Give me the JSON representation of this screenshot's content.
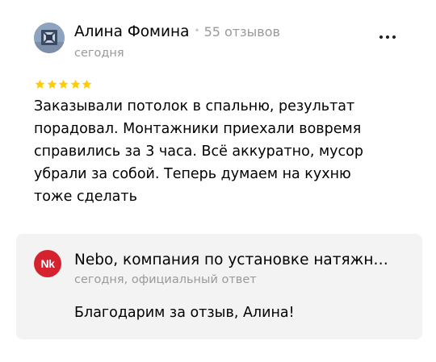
{
  "review": {
    "author_name": "Алина Фомина",
    "separator": "•",
    "review_count": "55 отзывов",
    "date": "сегодня",
    "rating": 5,
    "rating_max": 5,
    "star_color": "#fc0",
    "menu_icon": "more-horizontal-icon",
    "text": "Заказывали потолок в спальню, результат порадовал. Монтажники приехали вовремя справились за 3 часа. Всё аккуратно, мусор убрали за собой. Теперь думаем на кухню тоже сделать"
  },
  "response": {
    "logo_text": "Nk",
    "logo_color": "#d6222e",
    "business_name": "Nebo, компания по установке натяжн…",
    "meta": "сегодня, официальный ответ",
    "text": "Благодарим за отзыв, Алина!",
    "background": "#f3f3f3"
  }
}
